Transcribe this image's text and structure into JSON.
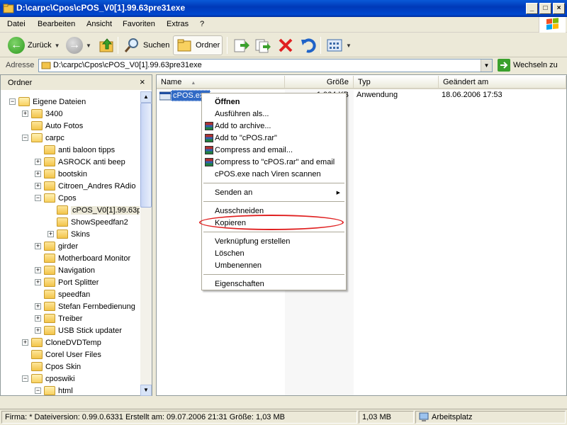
{
  "window": {
    "title": "D:\\carpc\\Cpos\\cPOS_V0[1].99.63pre31exe",
    "buttons": {
      "minimize": "_",
      "maximize": "□",
      "close": "×"
    }
  },
  "menubar": [
    "Datei",
    "Bearbeiten",
    "Ansicht",
    "Favoriten",
    "Extras",
    "?"
  ],
  "toolbar": {
    "back_label": "Zurück",
    "search_label": "Suchen",
    "folders_label": "Ordner"
  },
  "address": {
    "label": "Adresse",
    "value": "D:\\carpc\\Cpos\\cPOS_V0[1].99.63pre31exe",
    "go_label": "Wechseln zu"
  },
  "folder_pane": {
    "title": "Ordner",
    "close": "×",
    "tree": [
      {
        "label": "Eigene Dateien",
        "level": 0,
        "expander": "−"
      },
      {
        "label": "3400",
        "level": 1,
        "expander": "+"
      },
      {
        "label": "Auto Fotos",
        "level": 1,
        "expander": ""
      },
      {
        "label": "carpc",
        "level": 1,
        "expander": "−"
      },
      {
        "label": "anti baloon tipps",
        "level": 2,
        "expander": ""
      },
      {
        "label": "ASROCK anti beep",
        "level": 2,
        "expander": "+"
      },
      {
        "label": "bootskin",
        "level": 2,
        "expander": "+"
      },
      {
        "label": "Citroen_Andres RAdio",
        "level": 2,
        "expander": "+"
      },
      {
        "label": "Cpos",
        "level": 2,
        "expander": "−"
      },
      {
        "label": "cPOS_V0[1].99.63p",
        "level": 3,
        "expander": "",
        "selected": true
      },
      {
        "label": "ShowSpeedfan2",
        "level": 3,
        "expander": ""
      },
      {
        "label": "Skins",
        "level": 3,
        "expander": "+"
      },
      {
        "label": "girder",
        "level": 2,
        "expander": "+"
      },
      {
        "label": "Motherboard Monitor",
        "level": 2,
        "expander": ""
      },
      {
        "label": "Navigation",
        "level": 2,
        "expander": "+"
      },
      {
        "label": "Port Splitter",
        "level": 2,
        "expander": "+"
      },
      {
        "label": "speedfan",
        "level": 2,
        "expander": ""
      },
      {
        "label": "Stefan Fernbedienung",
        "level": 2,
        "expander": "+"
      },
      {
        "label": "Treiber",
        "level": 2,
        "expander": "+"
      },
      {
        "label": "USB Stick updater",
        "level": 2,
        "expander": "+"
      },
      {
        "label": "CloneDVDTemp",
        "level": 1,
        "expander": "+"
      },
      {
        "label": "Corel User Files",
        "level": 1,
        "expander": ""
      },
      {
        "label": "Cpos Skin",
        "level": 1,
        "expander": ""
      },
      {
        "label": "cposwiki",
        "level": 1,
        "expander": "−"
      },
      {
        "label": "html",
        "level": 2,
        "expander": "−"
      }
    ]
  },
  "file_list": {
    "columns": [
      "Name",
      "Größe",
      "Typ",
      "Geändert am"
    ],
    "rows": [
      {
        "name": "cPOS.exe",
        "size": "1.064 KB",
        "type": "Anwendung",
        "modified": "18.06.2006 17:53"
      }
    ]
  },
  "context_menu": {
    "items": [
      {
        "label": "Öffnen",
        "bold": true
      },
      {
        "label": "Ausführen als..."
      },
      {
        "label": "Add to archive...",
        "icon": "rar"
      },
      {
        "label": "Add to \"cPOS.rar\"",
        "icon": "rar"
      },
      {
        "label": "Compress and email...",
        "icon": "rar"
      },
      {
        "label": "Compress to \"cPOS.rar\" and email",
        "icon": "rar"
      },
      {
        "label": "cPOS.exe nach Viren scannen"
      },
      {
        "separator": true
      },
      {
        "label": "Senden an",
        "submenu": true
      },
      {
        "separator": true
      },
      {
        "label": "Ausschneiden"
      },
      {
        "label": "Kopieren",
        "highlighted": true
      },
      {
        "separator": true
      },
      {
        "label": "Verknüpfung erstellen"
      },
      {
        "label": "Löschen"
      },
      {
        "label": "Umbenennen"
      },
      {
        "separator": true
      },
      {
        "label": "Eigenschaften"
      }
    ],
    "submenu_arrow": "▶"
  },
  "statusbar": {
    "info": "Firma: * Dateiversion: 0.99.0.6331 Erstellt am: 09.07.2006 21:31 Größe: 1,03 MB",
    "size": "1,03 MB",
    "zone": "Arbeitsplatz"
  },
  "colors": {
    "title_bar": "#0a5ad8",
    "selection": "#316ac5",
    "highlight_ellipse": "#e02020"
  }
}
